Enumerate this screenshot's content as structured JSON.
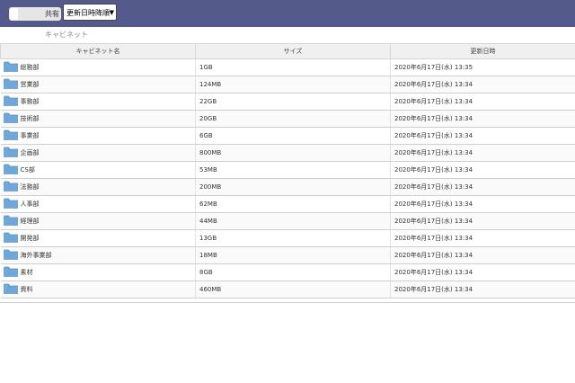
{
  "toolbar": {
    "share_toggle_label": "共有",
    "sort_select_value": "更新日時降順",
    "sort_chevron_icon": "chevron-down-icon"
  },
  "breadcrumb": {
    "root": "キャビネット"
  },
  "table": {
    "headers": {
      "name": "キャビネット名",
      "size": "サイズ",
      "updated": "更新日時"
    },
    "rows": [
      {
        "name": "総務部",
        "size": "1GB",
        "updated": "2020年6月17日(水) 13:35"
      },
      {
        "name": "営業部",
        "size": "124MB",
        "updated": "2020年6月17日(水) 13:34"
      },
      {
        "name": "事務部",
        "size": "22GB",
        "updated": "2020年6月17日(水) 13:34"
      },
      {
        "name": "技術部",
        "size": "20GB",
        "updated": "2020年6月17日(水) 13:34"
      },
      {
        "name": "事業部",
        "size": "6GB",
        "updated": "2020年6月17日(水) 13:34"
      },
      {
        "name": "企画部",
        "size": "800MB",
        "updated": "2020年6月17日(水) 13:34"
      },
      {
        "name": "CS部",
        "size": "53MB",
        "updated": "2020年6月17日(水) 13:34"
      },
      {
        "name": "法務部",
        "size": "200MB",
        "updated": "2020年6月17日(水) 13:34"
      },
      {
        "name": "人事部",
        "size": "62MB",
        "updated": "2020年6月17日(水) 13:34"
      },
      {
        "name": "経理部",
        "size": "44MB",
        "updated": "2020年6月17日(水) 13:34"
      },
      {
        "name": "開発部",
        "size": "13GB",
        "updated": "2020年6月17日(水) 13:34"
      },
      {
        "name": "海外事業部",
        "size": "18MB",
        "updated": "2020年6月17日(水) 13:34"
      },
      {
        "name": "素材",
        "size": "8GB",
        "updated": "2020年6月17日(水) 13:34"
      },
      {
        "name": "資料",
        "size": "460MB",
        "updated": "2020年6月17日(水) 13:34"
      }
    ]
  },
  "colors": {
    "topbar": "#555a8c",
    "header_bg": "#f0f0f0",
    "folder_fill": "#6fa8d8",
    "folder_tab": "#5b93c5"
  },
  "icons": {
    "row_icon": "folder-icon"
  }
}
